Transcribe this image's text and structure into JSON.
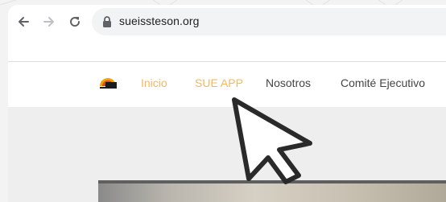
{
  "browser": {
    "url": "sueissteson.org",
    "icons": {
      "back": "arrow-left-icon",
      "forward": "arrow-right-icon",
      "reload": "reload-icon",
      "lock": "lock-icon"
    }
  },
  "site": {
    "logo_icon": "sue-logo",
    "nav": {
      "items": [
        {
          "label": "Inicio",
          "color": "#f5b75f"
        },
        {
          "label": "SUE APP",
          "color": "#f5b75f"
        },
        {
          "label": "Nosotros",
          "color": "#444444"
        },
        {
          "label": "Comité Ejecutivo",
          "color": "#444444"
        }
      ]
    }
  },
  "overlay": {
    "cursor_icon": "mouse-pointer-icon"
  }
}
